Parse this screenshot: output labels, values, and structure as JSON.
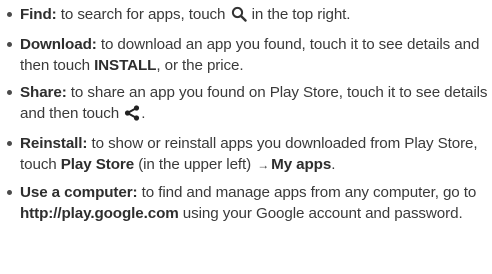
{
  "items": [
    {
      "term": "Find:",
      "text_before_icon": " to search for apps, touch ",
      "icon": "search-icon",
      "text_after_icon": " in the top right."
    },
    {
      "term": "Download:",
      "text_before": " to download an app you found, touch it to see details and then touch ",
      "bold": "INSTALL",
      "text_after": ", or the price."
    },
    {
      "term": "Share:",
      "text_before_icon": " to share an app you found on Play Store, touch it to see details and then touch ",
      "icon": "share-icon",
      "text_after_icon": "."
    },
    {
      "term": "Reinstall:",
      "text_before": " to show or reinstall apps you downloaded from Play Store, touch ",
      "bold1": "Play Store",
      "text_middle": " (in the upper left) ",
      "arrow": "→",
      "bold2": "My apps",
      "text_after": "."
    },
    {
      "term": "Use a computer:",
      "text_before": " to find and manage apps from any computer, go to ",
      "url": "http://play.google.com",
      "text_after": " using your Google account and password."
    }
  ]
}
